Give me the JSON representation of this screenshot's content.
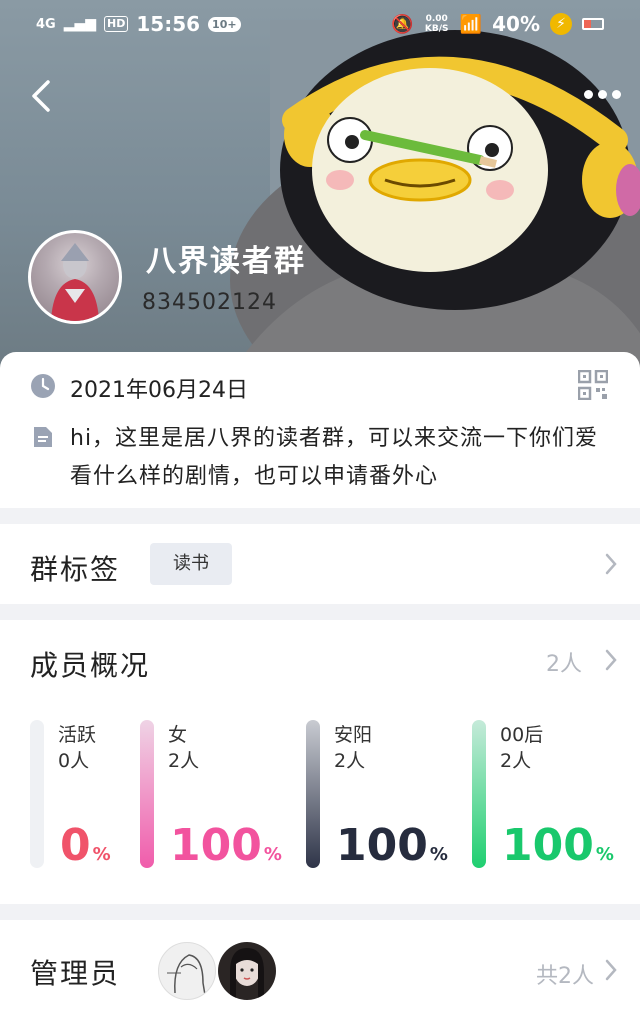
{
  "status_bar": {
    "network": "4G",
    "hd": "HD",
    "time": "15:56",
    "badge": "10+",
    "net_speed": "0.00 KB/S",
    "battery": "40%"
  },
  "group": {
    "name": "八界读者群",
    "id": "834502124",
    "created_date": "2021年06月24日",
    "description": "hi，这里是居八界的读者群，可以来交流一下你们爱看什么样的剧情，也可以申请番外心"
  },
  "tags_section": {
    "title": "群标签",
    "tags": [
      "读书"
    ]
  },
  "members_section": {
    "title": "成员概况",
    "count": "2人",
    "stats": [
      {
        "label": "活跃",
        "count": "0人",
        "percent": "0",
        "unit": "%",
        "level": 0,
        "color": "#f0536a",
        "bar_color": "#eff1f4"
      },
      {
        "label": "女",
        "count": "2人",
        "percent": "100",
        "unit": "%",
        "level": 1,
        "color": "#f2539e",
        "bar_color": "#f05cab"
      },
      {
        "label": "安阳",
        "count": "2人",
        "percent": "100",
        "unit": "%",
        "level": 1,
        "color": "#262c3e",
        "bar_color": "#2e3448"
      },
      {
        "label": "00后",
        "count": "2人",
        "percent": "100",
        "unit": "%",
        "level": 1,
        "color": "#19c86c",
        "bar_color": "#1fcf70"
      }
    ]
  },
  "admins_section": {
    "title": "管理员",
    "total": "共2人"
  }
}
